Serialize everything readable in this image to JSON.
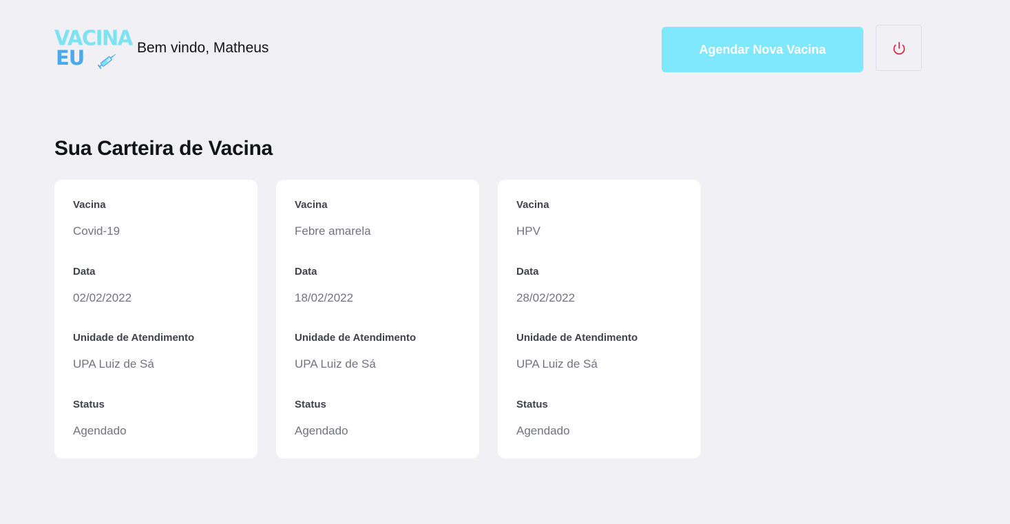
{
  "header": {
    "logo": {
      "line1": "VACINA",
      "line2": "EU",
      "icon": "syringe-icon"
    },
    "welcome_text": "Bem vindo, Matheus",
    "new_vaccine_button_label": "Agendar Nova Vacina",
    "logout_icon": "power-icon"
  },
  "main": {
    "title": "Sua Carteira de Vacina",
    "cards": [
      {
        "vaccine_label": "Vacina",
        "vaccine": "Covid-19",
        "date_label": "Data",
        "date": "02/02/2022",
        "unit_label": "Unidade de Atendimento",
        "unit": "UPA Luiz de Sá",
        "status_label": "Status",
        "status": "Agendado"
      },
      {
        "vaccine_label": "Vacina",
        "vaccine": "Febre amarela",
        "date_label": "Data",
        "date": "18/02/2022",
        "unit_label": "Unidade de Atendimento",
        "unit": "UPA Luiz de Sá",
        "status_label": "Status",
        "status": "Agendado"
      },
      {
        "vaccine_label": "Vacina",
        "vaccine": "HPV",
        "date_label": "Data",
        "date": "28/02/2022",
        "unit_label": "Unidade de Atendimento",
        "unit": "UPA Luiz de Sá",
        "status_label": "Status",
        "status": "Agendado"
      }
    ]
  },
  "colors": {
    "background": "#f0f0f5",
    "accent": "#7fe8fd",
    "logo_light": "#7de3f3",
    "logo_dark": "#4aa9ec",
    "logout_icon": "#e02041",
    "label_text": "#41414d",
    "value_text": "#737380"
  }
}
